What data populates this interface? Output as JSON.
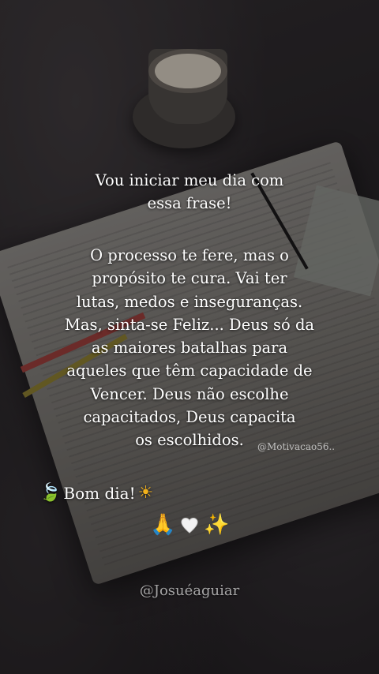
{
  "post": {
    "intro": "Vou iniciar meu dia com\nessa frase!",
    "body": "O processo te fere, mas o\npropósito te cura. Vai ter\nlutas, medos e inseguranças.\nMas, sinta-se Feliz... Deus só da\nas maiores batalhas para\naqueles que têm capacidade de\nVencer. Deus não escolhe\ncapacitados, Deus capacita\nos escolhidos.",
    "watermark": "@Motivacao56..",
    "greeting": "Bom dia!",
    "greeting_leaf": "🍃",
    "greeting_sun": "☀",
    "emoji_pray": "🙏",
    "emoji_sparkles": "✨",
    "credit": "@Josuéaguiar"
  },
  "colors": {
    "text": "#ffffff",
    "leaf": "#5fbf4a",
    "sun": "#f3b21b",
    "heart": "#f2f2f2"
  },
  "icons": [
    "leaf-icon",
    "sun-icon",
    "praying-hands-icon",
    "white-heart-icon",
    "sparkles-icon"
  ]
}
